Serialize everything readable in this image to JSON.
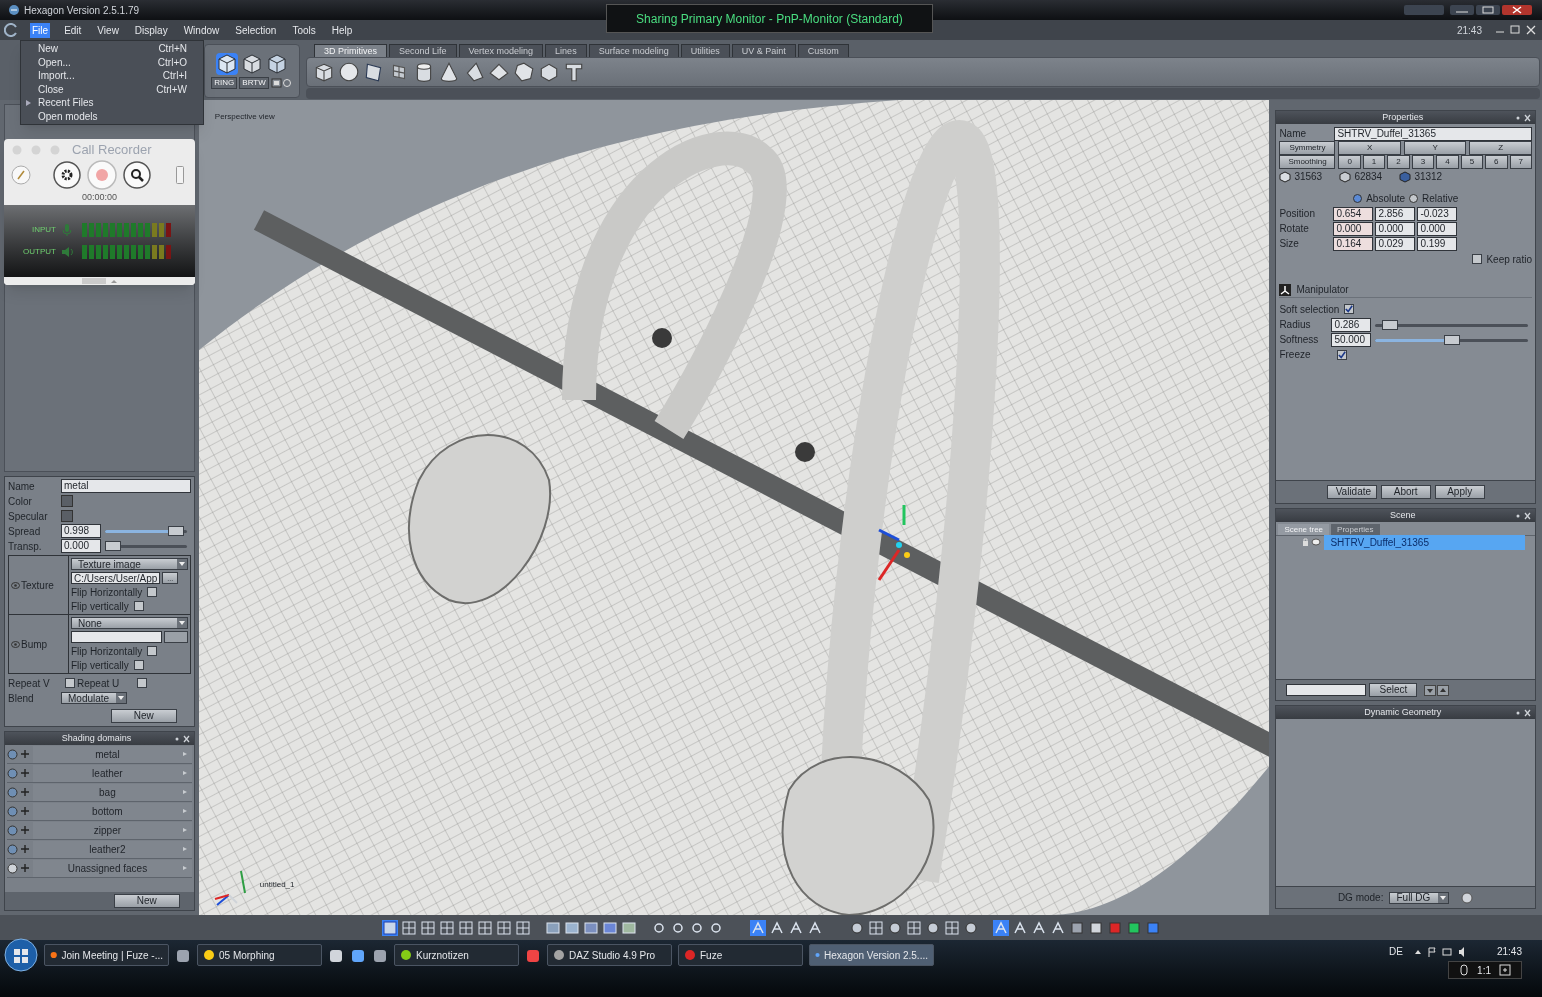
{
  "window": {
    "title": "Hexagon Version 2.5.1.79"
  },
  "share_banner": {
    "text": "Sharing Primary Monitor - PnP-Monitor (Standard)"
  },
  "menu": [
    {
      "label": "File",
      "selected": true
    },
    {
      "label": "Edit",
      "selected": false
    },
    {
      "label": "View",
      "selected": false
    },
    {
      "label": "Display",
      "selected": false
    },
    {
      "label": "Window",
      "selected": false
    },
    {
      "label": "Selection",
      "selected": false
    },
    {
      "label": "Tools",
      "selected": false
    },
    {
      "label": "Help",
      "selected": false
    }
  ],
  "clock": "21:43",
  "file_menu": [
    {
      "label": "New",
      "shortcut": "Ctrl+N",
      "submenu": false
    },
    {
      "label": "Open...",
      "shortcut": "Ctrl+O",
      "submenu": false
    },
    {
      "label": "Import...",
      "shortcut": "Ctrl+I",
      "submenu": false
    },
    {
      "label": "Close",
      "shortcut": "Ctrl+W",
      "submenu": false
    },
    {
      "label": "Recent Files",
      "submenu": true
    },
    {
      "label": "Open models",
      "submenu": false
    }
  ],
  "mode_buttons": [
    "RING",
    "BRTW"
  ],
  "tabs": [
    {
      "label": "3D Primitives",
      "selected": true
    },
    {
      "label": "Second Life",
      "selected": false
    },
    {
      "label": "Vertex modeling",
      "selected": false
    },
    {
      "label": "Lines",
      "selected": false
    },
    {
      "label": "Surface modeling",
      "selected": false
    },
    {
      "label": "Utilities",
      "selected": false
    },
    {
      "label": "UV & Paint",
      "selected": false
    },
    {
      "label": "Custom",
      "selected": false
    }
  ],
  "viewport": {
    "label": "Perspective view",
    "object_label": "untitled_1"
  },
  "call_recorder": {
    "title": "Call Recorder",
    "timer": "00:00:00",
    "meters": [
      {
        "label": "INPUT"
      },
      {
        "label": "OUTPUT"
      }
    ]
  },
  "material": {
    "name_label": "Name",
    "name": "metal",
    "color_label": "Color",
    "specular_label": "Specular",
    "sliders": [
      {
        "label": "Spread",
        "value": "0.998",
        "level": 0.95
      },
      {
        "label": "Transp.",
        "value": "0.000",
        "level": 0.0
      }
    ],
    "maps": [
      {
        "label": "Texture",
        "source": "Texture image",
        "path": "C:/Users/User/App",
        "browse": "...",
        "flips": [
          {
            "label": "Flip Horizontally",
            "checked": false
          },
          {
            "label": "Flip vertically",
            "checked": false
          }
        ]
      },
      {
        "label": "Bump",
        "source": "None",
        "flips": [
          {
            "label": "Flip Horizontally",
            "checked": false
          },
          {
            "label": "Flip vertically",
            "checked": false
          }
        ]
      }
    ],
    "repeat": [
      {
        "label": "Repeat V",
        "checked": false
      },
      {
        "label": "Repeat U",
        "checked": false
      }
    ],
    "blend_label": "Blend",
    "blend": "Modulate",
    "button": "New"
  },
  "shading_domains": {
    "title": "Shading domains",
    "items": [
      "metal",
      "leather",
      "bag",
      "bottom",
      "zipper",
      "leather2",
      "Unassigned faces"
    ],
    "button": "New"
  },
  "properties": {
    "title": "Properties",
    "name_label": "Name",
    "name": "SHTRV_Duffel_31365",
    "symmetry": "Symmetry",
    "axes": [
      "X",
      "Y",
      "Z"
    ],
    "smoothing": "Smoothing",
    "levels": [
      "0",
      "1",
      "2",
      "3",
      "4",
      "5",
      "6",
      "7"
    ],
    "counts": [
      "31563",
      "62834",
      "31312"
    ],
    "modes": [
      {
        "label": "Absolute",
        "selected": true
      },
      {
        "label": "Relative",
        "selected": false
      }
    ],
    "transforms": [
      {
        "label": "Position",
        "values": [
          "0.654",
          "2.856",
          "-0.023"
        ]
      },
      {
        "label": "Rotate",
        "values": [
          "0.000",
          "0.000",
          "0.000"
        ]
      },
      {
        "label": "Size",
        "values": [
          "0.164",
          "0.029",
          "0.199"
        ]
      }
    ],
    "keep_ratio": {
      "label": "Keep ratio",
      "checked": false
    },
    "manipulator": "Manipulator",
    "soft_selection": {
      "label": "Soft selection",
      "checked": true
    },
    "sliders": [
      {
        "label": "Radius",
        "value": "0.286",
        "level": 0.05
      },
      {
        "label": "Softness",
        "value": "50.000",
        "level": 0.5
      }
    ],
    "freeze": {
      "label": "Freeze",
      "checked": true
    },
    "buttons": [
      "Validate",
      "Abort",
      "Apply"
    ]
  },
  "scene": {
    "title": "Scene",
    "tabs": [
      {
        "label": "Scene tree",
        "selected": true
      },
      {
        "label": "Properties",
        "selected": false
      }
    ],
    "tree": [
      {
        "label": "SHTRV_Duffel_31365",
        "selected": true
      }
    ],
    "select_button": "Select"
  },
  "dynamic_geometry": {
    "title": "Dynamic Geometry",
    "mode_label": "DG mode:",
    "mode": "Full DG"
  },
  "taskbar": {
    "tasks": [
      {
        "label": "Join Meeting | Fuze -...",
        "selected": false
      },
      {
        "label": "05 Morphing",
        "selected": false
      },
      {
        "label": "Kurznotizen",
        "selected": false
      },
      {
        "label": "DAZ Studio 4.9 Pro",
        "selected": false
      },
      {
        "label": "Fuze",
        "selected": false
      },
      {
        "label": "Hexagon Version 2.5....",
        "selected": true
      }
    ],
    "language": "DE",
    "time": "21:43",
    "zoom": "1:1"
  }
}
